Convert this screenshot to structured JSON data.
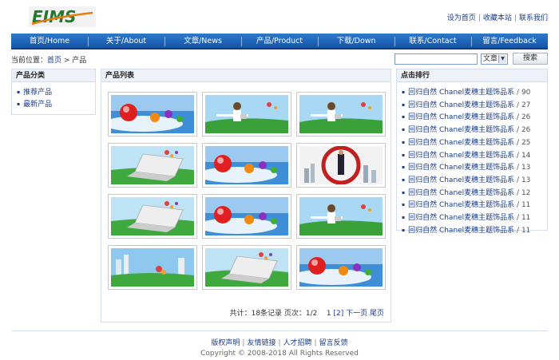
{
  "logo": {
    "text": "EIMS"
  },
  "top_links": [
    "设为首页",
    "收藏本站",
    "联系我们"
  ],
  "nav": [
    "首页/Home",
    "关于/About",
    "文章/News",
    "产品/Product",
    "下载/Down",
    "联系/Contact",
    "留言/Feedback"
  ],
  "breadcrumb": {
    "label": "当前位置：",
    "home": "首页",
    "sep": " > ",
    "current": "产品"
  },
  "search": {
    "value": "",
    "select_value": "文章",
    "button": "搜索"
  },
  "left_panel": {
    "title": "产品分类",
    "items": [
      "推荐产品",
      "最新产品"
    ]
  },
  "mid_panel": {
    "title": "产品列表",
    "thumbs": [
      "balls",
      "woman",
      "woman",
      "laptop",
      "balls",
      "business",
      "laptop",
      "balls",
      "woman",
      "city",
      "laptop",
      "balls"
    ],
    "pager": {
      "summary": "共计：18条记录 页次：1/2",
      "pages": [
        "1",
        "[2]"
      ],
      "next": "下一页",
      "last": "尾页"
    }
  },
  "right_panel": {
    "title": "点击排行",
    "items": [
      {
        "title": "回归自然 Chanel麦穗主题饰品系",
        "count": "90"
      },
      {
        "title": "回归自然 Chanel麦穗主题饰品系",
        "count": "27"
      },
      {
        "title": "回归自然 Chanel麦穗主题饰品系",
        "count": "26"
      },
      {
        "title": "回归自然 Chanel麦穗主题饰品系",
        "count": "26"
      },
      {
        "title": "回归自然 Chanel麦穗主题饰品系",
        "count": "25"
      },
      {
        "title": "回归自然 Chanel麦穗主题饰品系",
        "count": "14"
      },
      {
        "title": "回归自然 Chanel麦穗主题饰品系",
        "count": "13"
      },
      {
        "title": "回归自然 Chanel麦穗主题饰品系",
        "count": "13"
      },
      {
        "title": "回归自然 Chanel麦穗主题饰品系",
        "count": "12"
      },
      {
        "title": "回归自然 Chanel麦穗主题饰品系",
        "count": "11"
      },
      {
        "title": "回归自然 Chanel麦穗主题饰品系",
        "count": "11"
      },
      {
        "title": "回归自然 Chanel麦穗主题饰品系",
        "count": "11"
      }
    ]
  },
  "footer": {
    "links": [
      "版权声明",
      "友情链接",
      "人才招聘",
      "留言反馈"
    ],
    "copyright": "Copyright © 2008-2018 All Rights Reserved"
  },
  "colors": {
    "nav": "#1f66b8",
    "link": "#1a3c8c",
    "logo_green": "#1f7a2e",
    "logo_orange": "#e87a12"
  }
}
